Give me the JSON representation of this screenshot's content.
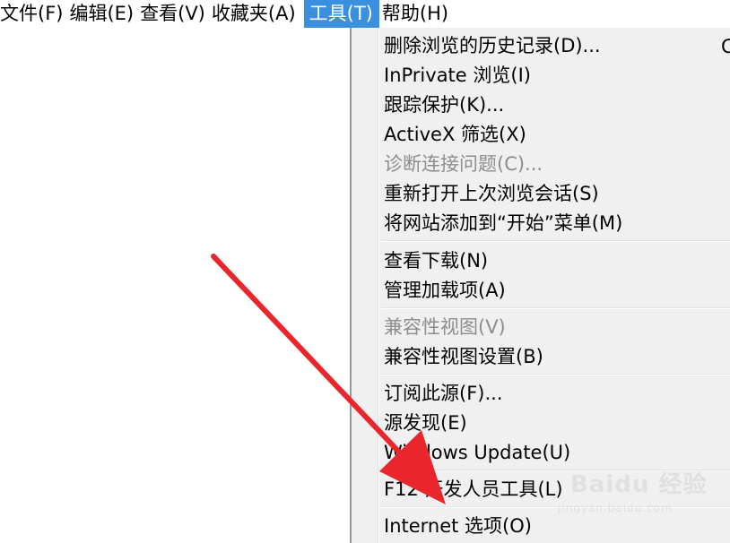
{
  "menubar": {
    "items": [
      {
        "label": "文件(F)"
      },
      {
        "label": "编辑(E)"
      },
      {
        "label": "查看(V)"
      },
      {
        "label": "收藏夹(A)"
      },
      {
        "label": "工具(T)"
      },
      {
        "label": "帮助(H)"
      }
    ],
    "active_index": 4
  },
  "tools_menu": {
    "groups": [
      [
        {
          "label": "删除浏览的历史记录(D)...",
          "enabled": true,
          "shortcut": "C"
        },
        {
          "label": "InPrivate 浏览(I)",
          "enabled": true
        },
        {
          "label": "跟踪保护(K)...",
          "enabled": true
        },
        {
          "label": "ActiveX 筛选(X)",
          "enabled": true
        },
        {
          "label": "诊断连接问题(C)...",
          "enabled": false
        },
        {
          "label": "重新打开上次浏览会话(S)",
          "enabled": true
        },
        {
          "label": "将网站添加到“开始”菜单(M)",
          "enabled": true
        }
      ],
      [
        {
          "label": "查看下载(N)",
          "enabled": true
        },
        {
          "label": "管理加载项(A)",
          "enabled": true
        }
      ],
      [
        {
          "label": "兼容性视图(V)",
          "enabled": false
        },
        {
          "label": "兼容性视图设置(B)",
          "enabled": true
        }
      ],
      [
        {
          "label": "订阅此源(F)...",
          "enabled": true
        },
        {
          "label": "源发现(E)",
          "enabled": true
        },
        {
          "label": "Windows Update(U)",
          "enabled": true
        }
      ],
      [
        {
          "label": "F12 开发人员工具(L)",
          "enabled": true
        }
      ],
      [
        {
          "label": "Internet 选项(O)",
          "enabled": true
        }
      ]
    ]
  },
  "colors": {
    "menu_highlight": "#3a8fde",
    "menu_background": "#f0f0f0",
    "disabled_text": "#8d8d8d",
    "annotation_arrow": "#e8262c"
  },
  "watermark": {
    "main": "Baidu 经验",
    "sub": "jingyan.baidu.com"
  }
}
